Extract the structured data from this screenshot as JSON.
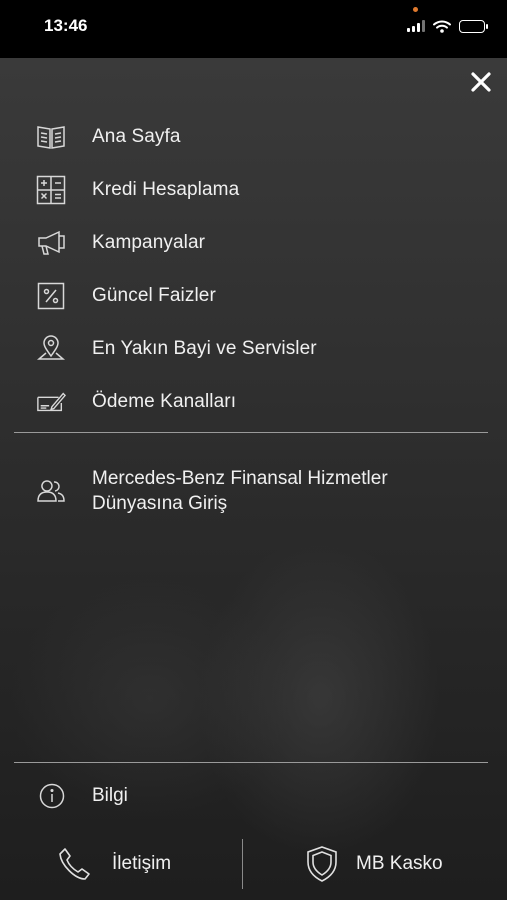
{
  "status_bar": {
    "time": "13:46",
    "icons": [
      "signal-icon",
      "wifi-icon",
      "battery-icon"
    ],
    "indicator_color": "#e07a2e"
  },
  "menu": {
    "close_icon": "close-icon",
    "items": [
      {
        "label": "Ana Sayfa",
        "icon": "book-icon"
      },
      {
        "label": "Kredi Hesaplama",
        "icon": "calculator-icon"
      },
      {
        "label": "Kampanyalar",
        "icon": "megaphone-icon"
      },
      {
        "label": "Güncel Faizler",
        "icon": "percent-icon"
      },
      {
        "label": "En Yakın Bayi ve Servisler",
        "icon": "location-pin-icon"
      },
      {
        "label": "Ödeme Kanalları",
        "icon": "payment-icon"
      }
    ],
    "login": {
      "label": "Mercedes-Benz Finansal Hizmetler Dünyasına Giriş",
      "icon": "users-icon"
    },
    "info": {
      "label": "Bilgi",
      "icon": "info-icon"
    },
    "bottom": {
      "contact_label": "İletişim",
      "contact_icon": "phone-icon",
      "kasko_label": "MB Kasko",
      "kasko_icon": "shield-icon"
    }
  }
}
